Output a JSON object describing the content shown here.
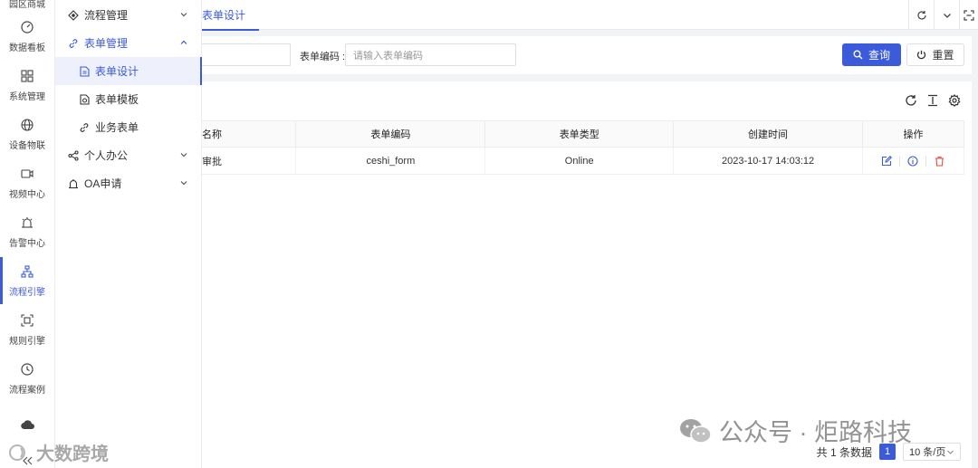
{
  "rail": {
    "top_label": "园区商城",
    "items": [
      {
        "label": "数据看板",
        "icon": "gauge-icon"
      },
      {
        "label": "系统管理",
        "icon": "grid-icon"
      },
      {
        "label": "设备物联",
        "icon": "globe-icon"
      },
      {
        "label": "视频中心",
        "icon": "video-icon"
      },
      {
        "label": "告警中心",
        "icon": "alarm-icon"
      },
      {
        "label": "流程引擎",
        "icon": "sitemap-icon",
        "active": true
      },
      {
        "label": "规则引擎",
        "icon": "scan-icon"
      },
      {
        "label": "流程案例",
        "icon": "clock-icon"
      },
      {
        "label": "",
        "icon": "cloud-icon"
      }
    ]
  },
  "submenu": {
    "items": [
      {
        "label": "流程管理"
      },
      {
        "label": "表单管理"
      },
      {
        "label": "表单设计"
      },
      {
        "label": "表单模板"
      },
      {
        "label": "业务表单"
      },
      {
        "label": "个人办公"
      },
      {
        "label": "OA申请"
      }
    ]
  },
  "tabs": {
    "active": "表单设计"
  },
  "search": {
    "code_label": "表单编码 :",
    "code_placeholder": "请输入表单编码",
    "query_label": "查询",
    "reset_label": "重置"
  },
  "table": {
    "headers": [
      "名称",
      "表单编码",
      "表单类型",
      "创建时间",
      "操作"
    ],
    "rows": [
      {
        "name": "审批",
        "code": "ceshi_form",
        "type": "Online",
        "created": "2023-10-17 14:03:12"
      }
    ]
  },
  "pagination": {
    "total_text": "共 1 条数据",
    "current_page": "1",
    "page_size": "10 条/页"
  },
  "watermark": {
    "right": "公众号 · 炬路科技",
    "left": "大数跨境"
  },
  "colors": {
    "accent": "#3b5bdb",
    "danger": "#e74c3c"
  }
}
